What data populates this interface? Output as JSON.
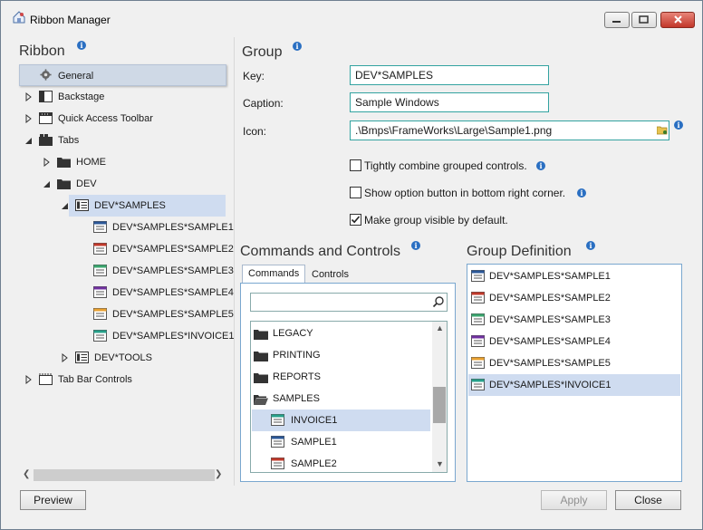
{
  "window": {
    "title": "Ribbon Manager"
  },
  "ribbon": {
    "heading": "Ribbon",
    "tree": [
      {
        "label": "General",
        "icon": "gear-icon"
      },
      {
        "label": "Backstage",
        "icon": "backstage-icon"
      },
      {
        "label": "Quick Access Toolbar",
        "icon": "toolbar-icon"
      },
      {
        "label": "Tabs",
        "icon": "tabs-icon"
      },
      {
        "label": "HOME",
        "icon": "folder-icon"
      },
      {
        "label": "DEV",
        "icon": "folder-icon"
      },
      {
        "label": "DEV*SAMPLES",
        "icon": "group-icon"
      },
      {
        "label": "DEV*SAMPLES*SAMPLE1",
        "icon": "control-icon"
      },
      {
        "label": "DEV*SAMPLES*SAMPLE2",
        "icon": "control-icon"
      },
      {
        "label": "DEV*SAMPLES*SAMPLE3",
        "icon": "control-icon"
      },
      {
        "label": "DEV*SAMPLES*SAMPLE4",
        "icon": "control-icon"
      },
      {
        "label": "DEV*SAMPLES*SAMPLE5",
        "icon": "control-icon"
      },
      {
        "label": "DEV*SAMPLES*INVOICE1",
        "icon": "control-icon"
      },
      {
        "label": "DEV*TOOLS",
        "icon": "group-icon"
      },
      {
        "label": "Tab Bar Controls",
        "icon": "tab-bar-icon"
      }
    ]
  },
  "group": {
    "heading": "Group",
    "key_label": "Key:",
    "key_value": "DEV*SAMPLES",
    "caption_label": "Caption:",
    "caption_value": "Sample Windows",
    "icon_label": "Icon:",
    "icon_value": ".\\Bmps\\FrameWorks\\Large\\Sample1.png",
    "checkboxes": [
      {
        "label": "Tightly combine grouped controls.",
        "checked": false
      },
      {
        "label": "Show option button in bottom right corner.",
        "checked": false
      },
      {
        "label": "Make group visible by default.",
        "checked": true
      }
    ]
  },
  "commands": {
    "heading": "Commands and Controls",
    "tabs": [
      "Commands",
      "Controls"
    ],
    "search_value": "",
    "items": [
      {
        "label": "LEGACY",
        "type": "folder"
      },
      {
        "label": "PRINTING",
        "type": "folder"
      },
      {
        "label": "REPORTS",
        "type": "folder"
      },
      {
        "label": "SAMPLES",
        "type": "folder-open"
      },
      {
        "label": "INVOICE1",
        "type": "control"
      },
      {
        "label": "SAMPLE1",
        "type": "control"
      },
      {
        "label": "SAMPLE2",
        "type": "control"
      }
    ]
  },
  "group_definition": {
    "heading": "Group Definition",
    "items": [
      "DEV*SAMPLES*SAMPLE1",
      "DEV*SAMPLES*SAMPLE2",
      "DEV*SAMPLES*SAMPLE3",
      "DEV*SAMPLES*SAMPLE4",
      "DEV*SAMPLES*SAMPLE5",
      "DEV*SAMPLES*INVOICE1"
    ]
  },
  "buttons": {
    "preview": "Preview",
    "apply": "Apply",
    "close": "Close"
  },
  "colors": {
    "sample1": "#2b5797",
    "sample2": "#c0392b",
    "sample3": "#3aa56e",
    "sample4": "#7030a0",
    "sample5": "#e8a030",
    "invoice1": "#27a08a",
    "selection": "#cfdcf0",
    "input_border": "#33a3a0"
  }
}
